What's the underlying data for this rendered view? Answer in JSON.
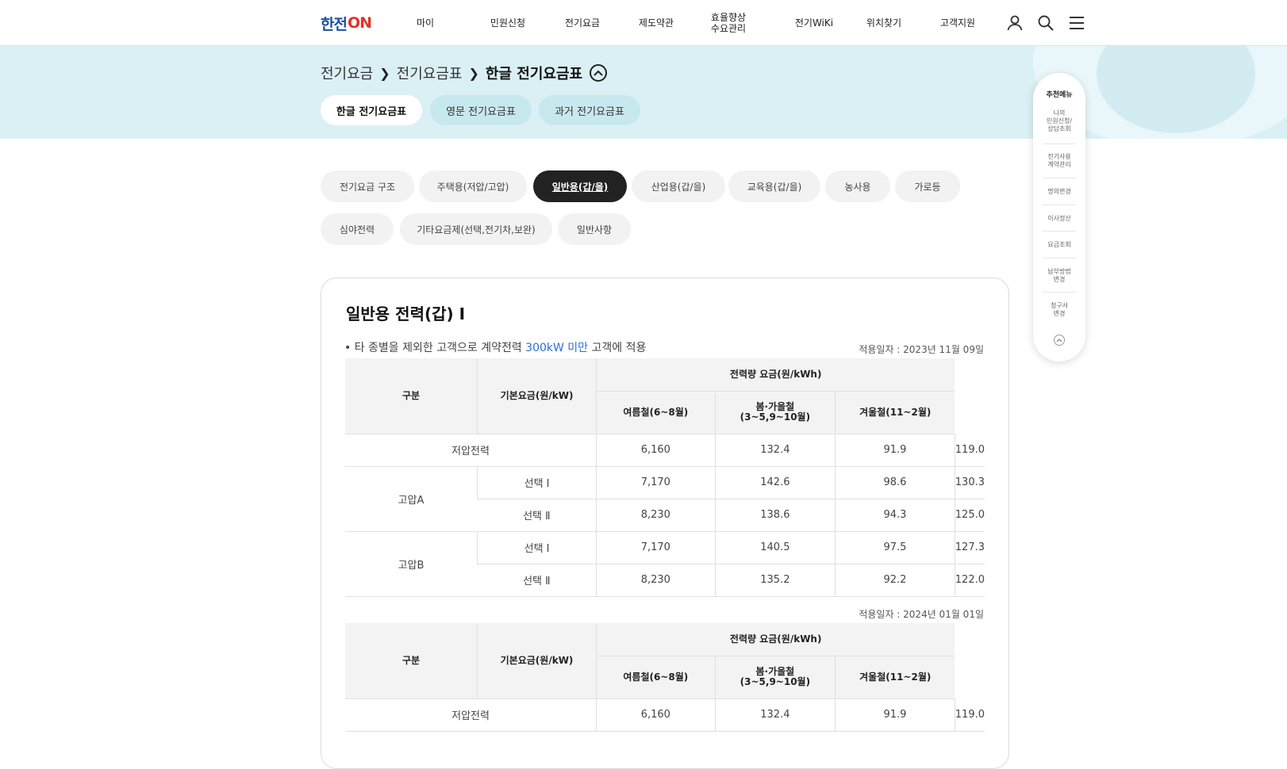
{
  "header": {
    "logo_main": "한전",
    "logo_on": "ON",
    "nav": [
      "마이",
      "민원신청",
      "전기요금",
      "제도약관",
      "효율향상\n수요관리",
      "전기WiKi",
      "위치찾기",
      "고객지원"
    ]
  },
  "breadcrumb": {
    "level1": "전기요금",
    "level2": "전기요금표",
    "current": "한글 전기요금표"
  },
  "subtabs": [
    "한글 전기요금표",
    "영문 전기요금표",
    "과거 전기요금표"
  ],
  "categories": [
    "전기요금 구조",
    "주택용(저압/고압)",
    "일반용(갑/을)",
    "산업용(갑/을)",
    "교육용(갑/을)",
    "농사용",
    "가로등",
    "심야전력",
    "기타요금제(선택,전기차,보완)",
    "일반사항"
  ],
  "active_category": "일반용(갑/을)",
  "section": {
    "title": "일반용 전력(갑) Ⅰ",
    "desc_prefix": "• 타 종별을 제외한 고객으로 계약전력 ",
    "desc_highlight": "300kW 미만",
    "desc_suffix": " 고객에 적용",
    "highlight_color": "#2b6fd6"
  },
  "table_header": {
    "col_gubun": "구분",
    "col_base": "기본요금(원/kW)",
    "col_energy": "전력량 요금(원/kWh)",
    "col_summer": "여름철(6~8월)",
    "col_spring": "봄·가을철\n(3~5,9~10월)",
    "col_winter": "겨울철(11~2월)"
  },
  "table1": {
    "applied": "적용일자 : 2023년 11월 09일",
    "low": {
      "label": "저압전력",
      "base": "6,160",
      "summer": "132.4",
      "spring": "91.9",
      "winter": "119.0"
    },
    "highA": {
      "label": "고압A",
      "rows": [
        {
          "opt": "선택 Ⅰ",
          "base": "7,170",
          "summer": "142.6",
          "spring": "98.6",
          "winter": "130.3"
        },
        {
          "opt": "선택 Ⅱ",
          "base": "8,230",
          "summer": "138.6",
          "spring": "94.3",
          "winter": "125.0"
        }
      ]
    },
    "highB": {
      "label": "고압B",
      "rows": [
        {
          "opt": "선택 Ⅰ",
          "base": "7,170",
          "summer": "140.5",
          "spring": "97.5",
          "winter": "127.3"
        },
        {
          "opt": "선택 Ⅱ",
          "base": "8,230",
          "summer": "135.2",
          "spring": "92.2",
          "winter": "122.0"
        }
      ]
    }
  },
  "table2": {
    "applied": "적용일자 : 2024년 01월 01일",
    "low": {
      "label": "저압전력",
      "base": "6,160",
      "summer": "132.4",
      "spring": "91.9",
      "winter": "119.0"
    }
  },
  "quickmenu": {
    "title": "추천메뉴",
    "items": [
      "나의\n민원신청/\n상담조회",
      "전기사용\n계약관리",
      "명의변경",
      "이사정산",
      "요금조회",
      "납부방법\n변경",
      "청구서\n변경"
    ]
  }
}
